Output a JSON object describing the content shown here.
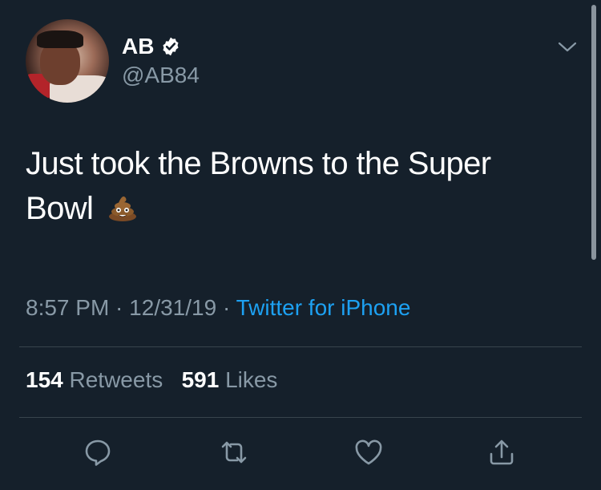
{
  "user": {
    "display_name": "AB",
    "handle": "@AB84",
    "verified_icon": "verified-badge-icon",
    "avatar_icon": "profile-avatar"
  },
  "tweet": {
    "text": "Just took the Browns to the Super Bowl",
    "emoji_icon": "pile-of-poo-emoji"
  },
  "meta": {
    "time": "8:57 PM",
    "sep1": " · ",
    "date": "12/31/19",
    "sep2": " · ",
    "source": "Twitter for iPhone"
  },
  "stats": {
    "retweets_count": "154",
    "retweets_label": "Retweets",
    "likes_count": "591",
    "likes_label": "Likes"
  },
  "actions": [
    "reply-icon",
    "retweet-icon",
    "like-icon",
    "share-icon"
  ],
  "colors": {
    "background": "#15202b",
    "text": "#ffffff",
    "secondary": "#8899a6",
    "link": "#1da1f2",
    "divider": "#38444d"
  }
}
